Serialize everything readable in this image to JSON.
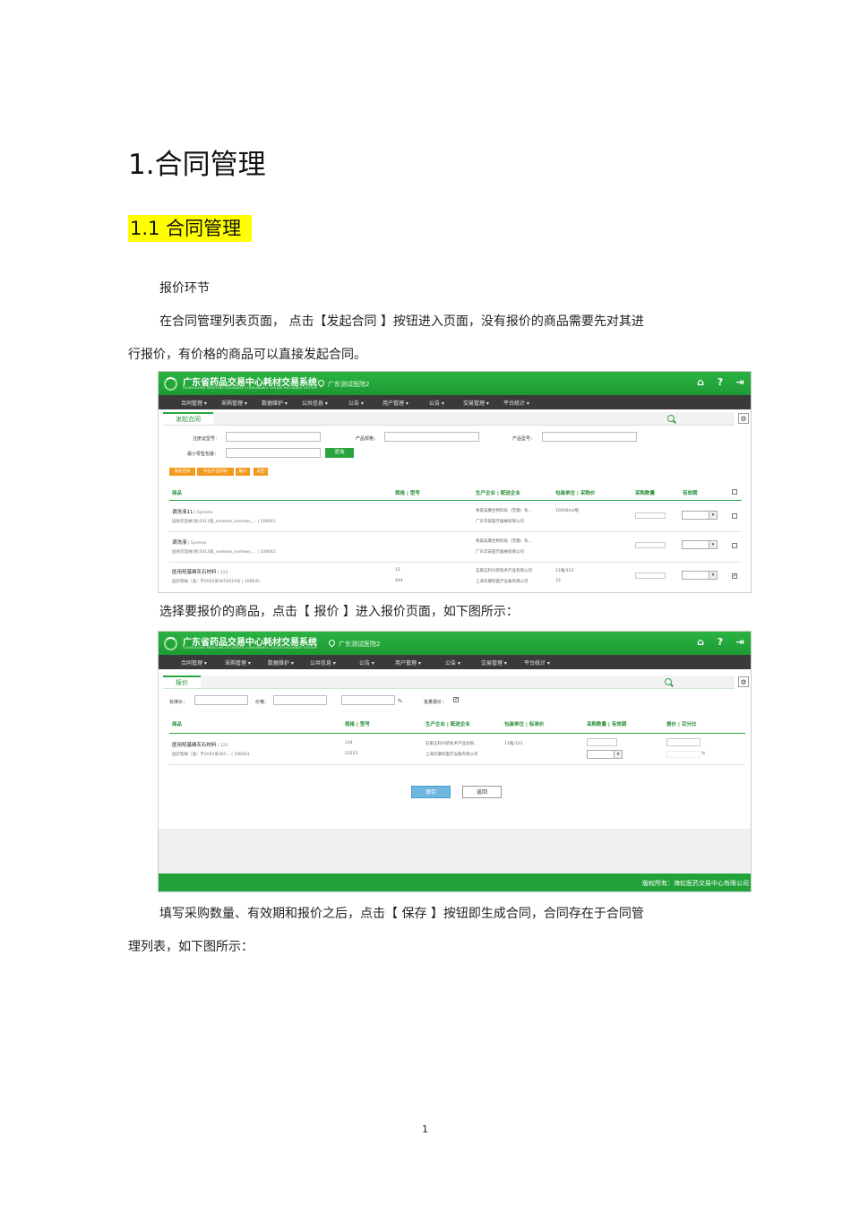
{
  "doc": {
    "h1": "1.合同管理",
    "h2": "1.1 合同管理",
    "p1": "报价环节",
    "p2_line1": "在合同管理列表页面，    点击【发起合同 】按钮进入页面，没有报价的商品需要先对其进",
    "p2_line2": "行报价，有价格的商品可以直接发起合同。",
    "p3": "选择要报价的商品，点击【    报价 】进入报价页面，如下图所示：",
    "p4_line1": "填写采购数量、有效期和报价之后，点击【     保存 】按钮即生成合同，合同存在于合同管",
    "p4_line2": "理列表，如下图所示：",
    "page_number": "1"
  },
  "app": {
    "title": "广东省药品交易中心耗材交易系统",
    "subtitle": "GUANGDONG MEDICINE EXCHANGE CONSUMABLE GOODS EXCHANGE SYSTEM",
    "location": "广东测试医院2",
    "icons": [
      "home-icon",
      "help-icon",
      "logout-icon"
    ],
    "nav": [
      "合同管理 ▾",
      "采购管理 ▾",
      "数据维护 ▾",
      "公共信息 ▾",
      "公告 ▾",
      "用户管理 ▾",
      "公告 ▾",
      "交易管理 ▾",
      "平台统计 ▾"
    ]
  },
  "shot1": {
    "tab": "发起合同",
    "filters": {
      "reg_label": "注册证型号：",
      "spec_label": "产品规格：",
      "model_label": "产品型号：",
      "pack_label": "最小零售包装：",
      "query_btn": "查询"
    },
    "actions": [
      "发起合同",
      "导出产品列表",
      "报价",
      "返回"
    ],
    "headers": {
      "product": "商品",
      "spec": "规格 | 型号",
      "company": "生产企业 | 配送企业",
      "unit": "包装单位 | 采购价",
      "qty": "采购数量",
      "expiry": "有效期"
    },
    "rows": [
      {
        "name": "调洗液11",
        "brand": " | Sysmex",
        "code": "国食药监械(进)2013第_xxmkws_xxmkws_... | 108041",
        "spec": "",
        "model": "",
        "mfr": "希森美康生物科技（无锡）有...",
        "dist": "广东华安医疗器械有限公司",
        "unit": "10000ml/瓶",
        "price": "",
        "checked": "false"
      },
      {
        "name": "调洗液",
        "brand": " | Sysmex",
        "code": "国食药监械(进)2013第_xxmkws_xxmkws_... | 108042",
        "spec": "",
        "model": "",
        "mfr": "希森美康生物科技（无锡）有...",
        "dist": "广东华安医疗器械有限公司",
        "unit": "",
        "price": "",
        "checked": "false"
      },
      {
        "name": "医用羟基磷灰石材料",
        "brand": " | 123",
        "code": "国药管械（准）字2002第3650019号 | 108045",
        "spec": "12",
        "model": "444",
        "mfr": "石家庄科兴新技术产品有限公司",
        "dist": "上海华康科医疗设备有限公司",
        "unit": "11瓶/123",
        "price": "33",
        "checked": "true"
      }
    ]
  },
  "shot2": {
    "tab": "报价",
    "filters": {
      "std_label": "标准价：",
      "price_label": "价格：",
      "pct": "%",
      "batch_label": "批量报价："
    },
    "headers": {
      "product": "商品",
      "spec": "规格 | 型号",
      "company": "生产企业 | 配送企业",
      "unit": "包装单位 | 标准价",
      "qty": "采购数量 | 有效期",
      "quote": "报价 | 百分比"
    },
    "row": {
      "name": "医用羟基磷灰石材料",
      "brand": " | 123",
      "code": "国药管械（准）字2002第365... | 108043",
      "spec": "134",
      "model": "23223",
      "mfr": "石家庄科兴新技术产品有限...",
      "dist": "上海华康科医疗设备有限公司",
      "unit": "11瓶/123",
      "pct": "%"
    },
    "save_btn": "保存",
    "back_btn": "返回",
    "footer": "版权所有：海虹医药交易中心有限公司"
  }
}
